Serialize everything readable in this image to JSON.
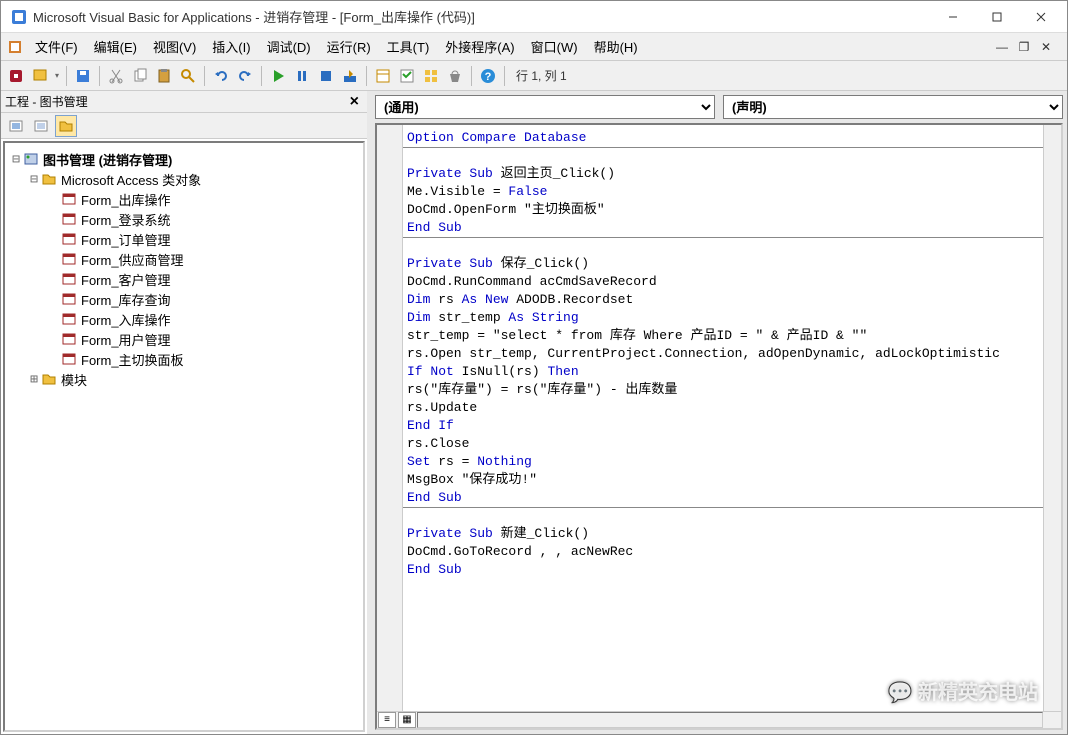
{
  "window": {
    "title": "Microsoft Visual Basic for Applications - 进销存管理 - [Form_出库操作 (代码)]"
  },
  "menu": {
    "file": "文件(F)",
    "edit": "编辑(E)",
    "view": "视图(V)",
    "insert": "插入(I)",
    "debug": "调试(D)",
    "run": "运行(R)",
    "tools": "工具(T)",
    "addins": "外接程序(A)",
    "window": "窗口(W)",
    "help": "帮助(H)"
  },
  "toolbar_status": "行 1, 列 1",
  "project_pane": {
    "title": "工程 - 图书管理",
    "root": "图书管理 (进销存管理)",
    "class_objects": "Microsoft Access 类对象",
    "forms": [
      "Form_出库操作",
      "Form_登录系统",
      "Form_订单管理",
      "Form_供应商管理",
      "Form_客户管理",
      "Form_库存查询",
      "Form_入库操作",
      "Form_用户管理",
      "Form_主切换面板"
    ],
    "modules": "模块"
  },
  "combo_left": "(通用)",
  "combo_right": "(声明)",
  "code": {
    "l1": "Option Compare Database",
    "l2": "",
    "l3": "Private Sub 返回主页_Click()",
    "l4": "Me.Visible = False",
    "l5": "DoCmd.OpenForm \"主切换面板\"",
    "l6": "End Sub",
    "l7": "",
    "l8": "Private Sub 保存_Click()",
    "l9": "DoCmd.RunCommand acCmdSaveRecord",
    "l10": "Dim rs As New ADODB.Recordset",
    "l11": "Dim str_temp As String",
    "l12": "str_temp = \"select * from 库存 Where 产品ID = \" & 产品ID & \"\"",
    "l13": "rs.Open str_temp, CurrentProject.Connection, adOpenDynamic, adLockOptimistic",
    "l14": "If Not IsNull(rs) Then",
    "l15": "rs(\"库存量\") = rs(\"库存量\") - 出库数量",
    "l16": "rs.Update",
    "l17": "End If",
    "l18": "rs.Close",
    "l19": "Set rs = Nothing",
    "l20": "MsgBox \"保存成功!\"",
    "l21": "End Sub",
    "l22": "",
    "l23": "Private Sub 新建_Click()",
    "l24": "DoCmd.GoToRecord , , acNewRec",
    "l25": "End Sub"
  },
  "watermark": "新精英充电站"
}
